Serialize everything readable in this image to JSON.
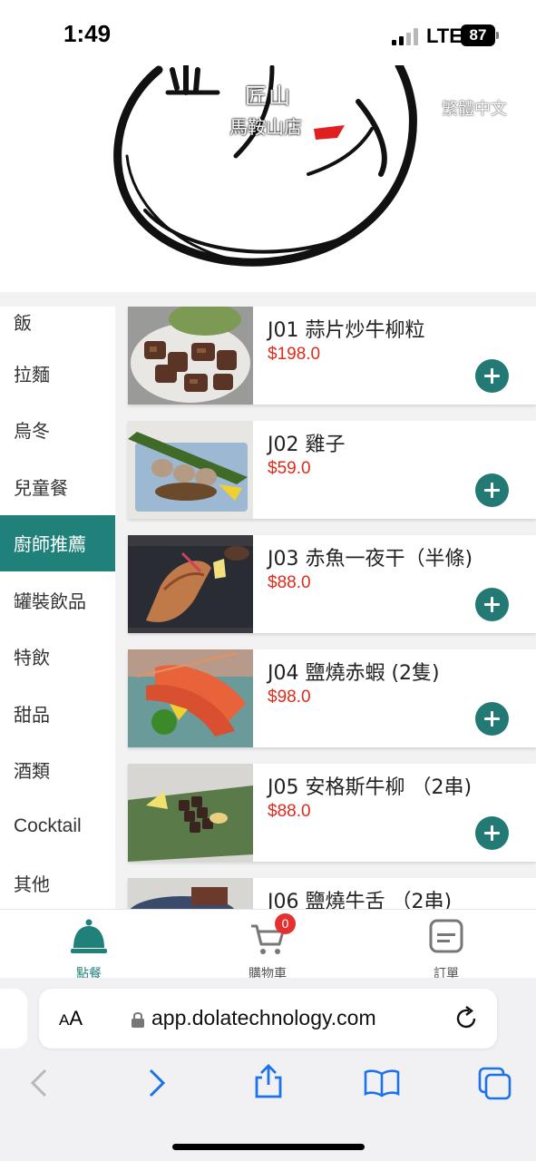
{
  "status_bar": {
    "time": "1:49",
    "network": "LTE",
    "battery": "87"
  },
  "header": {
    "logo_title": "匠山",
    "logo_subtitle": "馬鞍山店",
    "language_label": "繁體中文"
  },
  "categories": [
    {
      "label": "飯"
    },
    {
      "label": "拉麵"
    },
    {
      "label": "烏冬"
    },
    {
      "label": "兒童餐"
    },
    {
      "label": "廚師推薦"
    },
    {
      "label": "罐裝飲品"
    },
    {
      "label": "特飲"
    },
    {
      "label": "甜品"
    },
    {
      "label": "酒類"
    },
    {
      "label": "Cocktail"
    },
    {
      "label": "其他"
    }
  ],
  "active_category": "廚師推薦",
  "menu_items": [
    {
      "name": "J01 蒜片炒牛柳粒",
      "price": "$198.0"
    },
    {
      "name": "J02 雞子",
      "price": "$59.0"
    },
    {
      "name": "J03 赤魚一夜干（半條)",
      "price": "$88.0"
    },
    {
      "name": "J04 鹽燒赤蝦 (2隻)",
      "price": "$98.0"
    },
    {
      "name": "J05 安格斯牛柳 （2串)",
      "price": "$88.0"
    },
    {
      "name": "J06 鹽燒牛舌 （2串)",
      "price": ""
    }
  ],
  "tabs": [
    {
      "label": "點餐",
      "icon": "cloche-icon",
      "active": true
    },
    {
      "label": "購物車",
      "icon": "cart-icon",
      "badge": "0"
    },
    {
      "label": "訂單",
      "icon": "receipt-icon"
    }
  ],
  "browser": {
    "text_size_label_small": "A",
    "text_size_label_big": "A",
    "url": "app.dolatechnology.com"
  },
  "colors": {
    "accent": "#20807a",
    "price": "#e02a1a",
    "badge": "#e53030"
  }
}
